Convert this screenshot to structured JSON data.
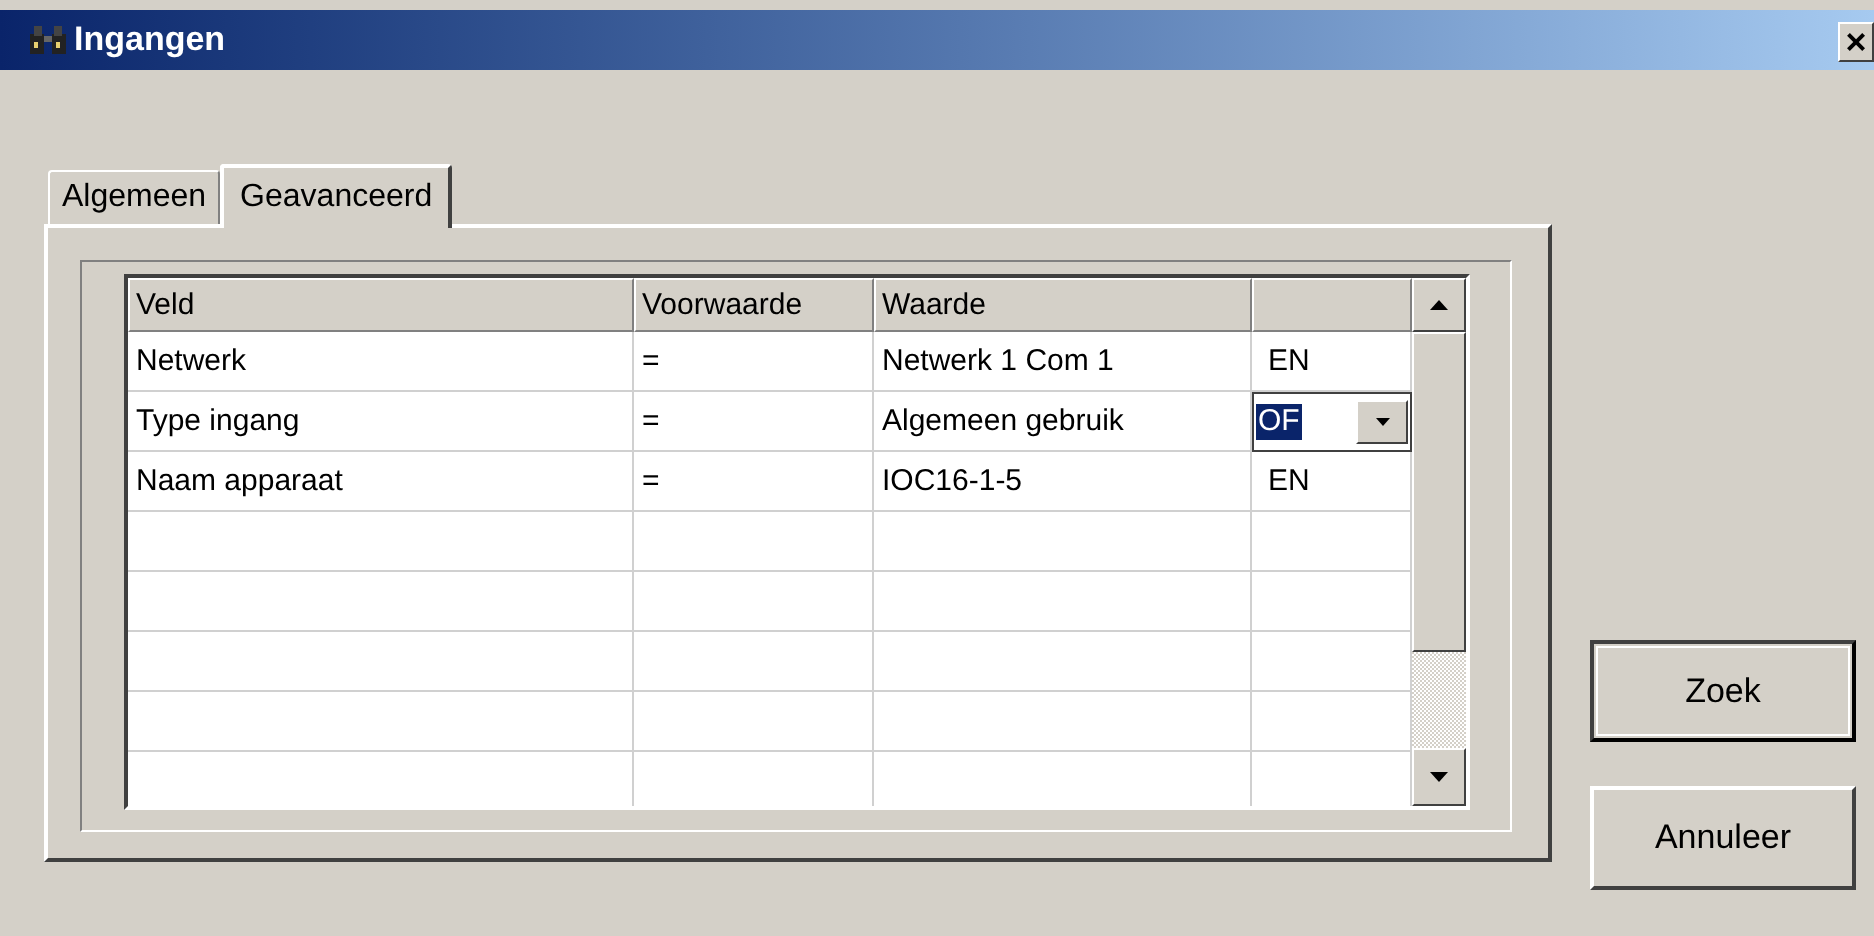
{
  "window": {
    "title": "Ingangen",
    "close": "×"
  },
  "tabs": [
    {
      "label": "Algemeen",
      "selected": false
    },
    {
      "label": "Geavanceerd",
      "selected": true
    }
  ],
  "table": {
    "columns": [
      "Veld",
      "Voorwaarde",
      "Waarde"
    ],
    "rows": [
      {
        "field": "Netwerk",
        "condition": "=",
        "value": "Netwerk 1 Com 1",
        "conjunction": "EN",
        "editing": false
      },
      {
        "field": "Type ingang",
        "condition": "=",
        "value": "Algemeen gebruik",
        "conjunction": "OF",
        "editing": true
      },
      {
        "field": "Naam apparaat",
        "condition": "=",
        "value": "IOC16-1-5",
        "conjunction": "EN",
        "editing": false
      }
    ]
  },
  "buttons": [
    {
      "label": "Zoek",
      "default": true
    },
    {
      "label": "Annuleer",
      "default": false
    }
  ]
}
